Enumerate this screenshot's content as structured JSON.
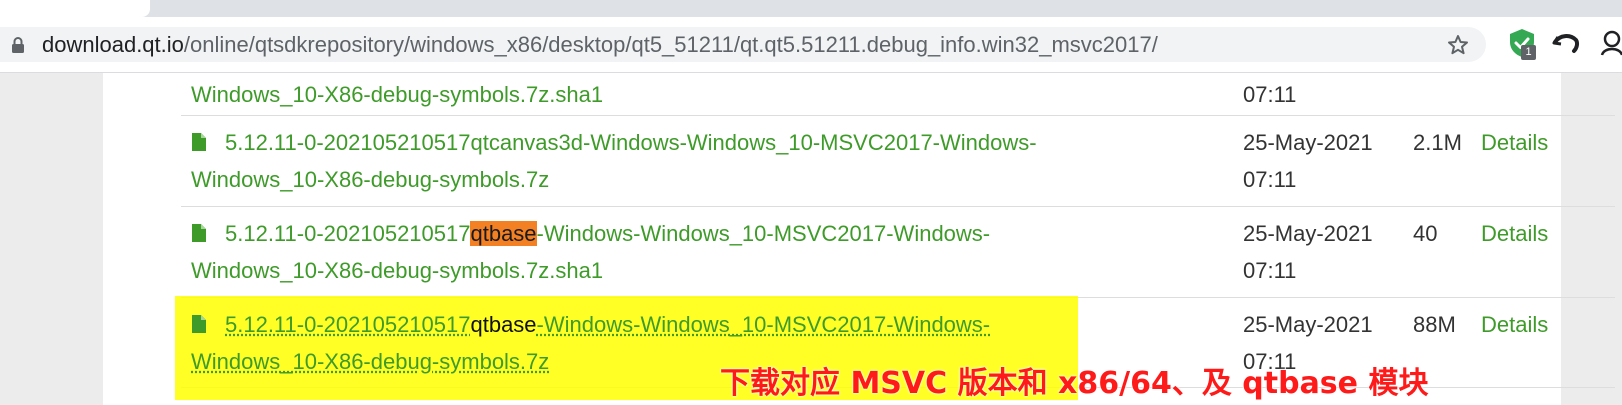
{
  "browser": {
    "tab_title": "",
    "url_host": "download.qt.io",
    "url_path": "/online/qtsdkrepository/windows_x86/desktop/qt5_51211/qt.qt5.51211.debug_info.win32_msvc2017/",
    "extension_badge": "1"
  },
  "listing": {
    "rows": [
      {
        "name_line1": "Windows_10-X86-debug-symbols.7z.sha1",
        "date_line2": "07:11"
      },
      {
        "name_line1": "5.12.11-0-202105210517qtcanvas3d-Windows-Windows_10-MSVC2017-Windows-",
        "name_line2": "Windows_10-X86-debug-symbols.7z",
        "date_line1": "25-May-2021",
        "date_line2": "07:11",
        "size": "2.1M",
        "details": "Details"
      },
      {
        "name_pre": "5.12.11-0-202105210517",
        "name_hl": "qtbase",
        "name_post": "-Windows-Windows_10-MSVC2017-Windows-",
        "name_line2": "Windows_10-X86-debug-symbols.7z.sha1",
        "date_line1": "25-May-2021",
        "date_line2": "07:11",
        "size": "40",
        "details": "Details"
      },
      {
        "name_pre": "5.12.11-0-202105210517",
        "name_hl": "qtbase",
        "name_post": "-Windows-Windows_10-MSVC2017-Windows-",
        "name_line2": "Windows_10-X86-debug-symbols.7z",
        "date_line1": "25-May-2021",
        "date_line2": "07:11",
        "size": "88M",
        "details": "Details"
      }
    ]
  },
  "annotation": {
    "text": "下载对应 MSVC 版本和 x86/64、及 qtbase 模块"
  },
  "colors": {
    "link": "#3e9b29",
    "highlight_orange": "#f48024",
    "highlight_yellow": "#ffff00",
    "annotation": "#ff1a1a"
  }
}
